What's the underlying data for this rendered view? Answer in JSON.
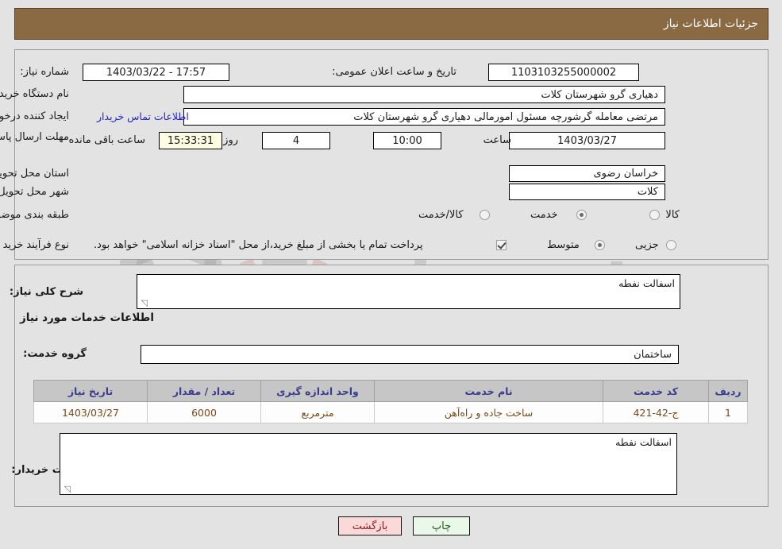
{
  "header": {
    "title": "جزئیات اطلاعات نیاز"
  },
  "info": {
    "need_number_label": "شماره نیاز:",
    "need_number_value": "1103103255000002",
    "announce_label": "تاریخ و ساعت اعلان عمومی:",
    "announce_value": "17:57 - 1403/03/22",
    "buyer_org_label": "نام دستگاه خریدار:",
    "buyer_org_value": "دهیاری گرو شهرستان کلات",
    "creator_label": "ایجاد کننده درخواست:",
    "creator_value": "مرتضی معامله گرشورچه مسئول امورمالی دهیاری گرو شهرستان کلات",
    "contact_link": "اطلاعات تماس خریدار",
    "deadline_label": "مهلت ارسال پاسخ: تا تاریخ:",
    "deadline_date": "1403/03/27",
    "hour_label": "ساعت",
    "deadline_time": "10:00",
    "days_left": "4",
    "days_word": "روز و",
    "countdown": "15:33:31",
    "countdown_suffix": "ساعت باقی مانده",
    "province_label": "استان محل تحویل:",
    "province_value": "خراسان رضوی",
    "city_label": "شهر محل تحویل:",
    "city_value": "کلات",
    "category_label": "طبقه بندی موضوعی:",
    "category_options": [
      {
        "label": "کالا",
        "selected": false
      },
      {
        "label": "خدمت",
        "selected": true
      },
      {
        "label": "کالا/خدمت",
        "selected": false
      }
    ],
    "process_label": "نوع فرآیند خرید :",
    "process_options": [
      {
        "label": "جزیی",
        "selected": false
      },
      {
        "label": "متوسط",
        "selected": true
      }
    ],
    "treasury_checkbox_checked": true,
    "treasury_text": "پرداخت تمام یا بخشی از مبلغ خرید،از محل \"اسناد خزانه اسلامی\" خواهد بود."
  },
  "details": {
    "general_desc_label": "شرح کلی نیاز:",
    "general_desc_value": "اسفالت نفطه",
    "section_title": "اطلاعات خدمات مورد نیاز",
    "service_group_label": "گروه خدمت:",
    "service_group_value": "ساختمان",
    "buyer_notes_label": "توضیحات خریدار:",
    "buyer_notes_value": "اسفالت نفطه"
  },
  "table": {
    "columns": [
      "ردیف",
      "کد خدمت",
      "نام خدمت",
      "واحد اندازه گیری",
      "تعداد / مقدار",
      "تاریخ نیاز"
    ],
    "rows": [
      {
        "row": "1",
        "code": "ج-42-421",
        "name": "ساخت جاده و راه‌آهن",
        "unit": "مترمربع",
        "quantity": "6000",
        "date": "1403/03/27"
      }
    ]
  },
  "footer": {
    "print_label": "چاپ",
    "back_label": "بازگشت"
  },
  "watermark": {
    "text": "AriaTender.net"
  },
  "colors": {
    "header_brown": "#8a6a43",
    "page_bg": "#e3e3e3",
    "link_blue": "#2222cc",
    "table_header_bg": "#c6c6c6",
    "table_header_text": "#3b3b8f",
    "table_cell_text": "#7a4a17",
    "print_btn_bg": "#e9f8e9",
    "back_btn_bg": "#fbd9d9",
    "countdown_bg": "#fdfde4"
  }
}
